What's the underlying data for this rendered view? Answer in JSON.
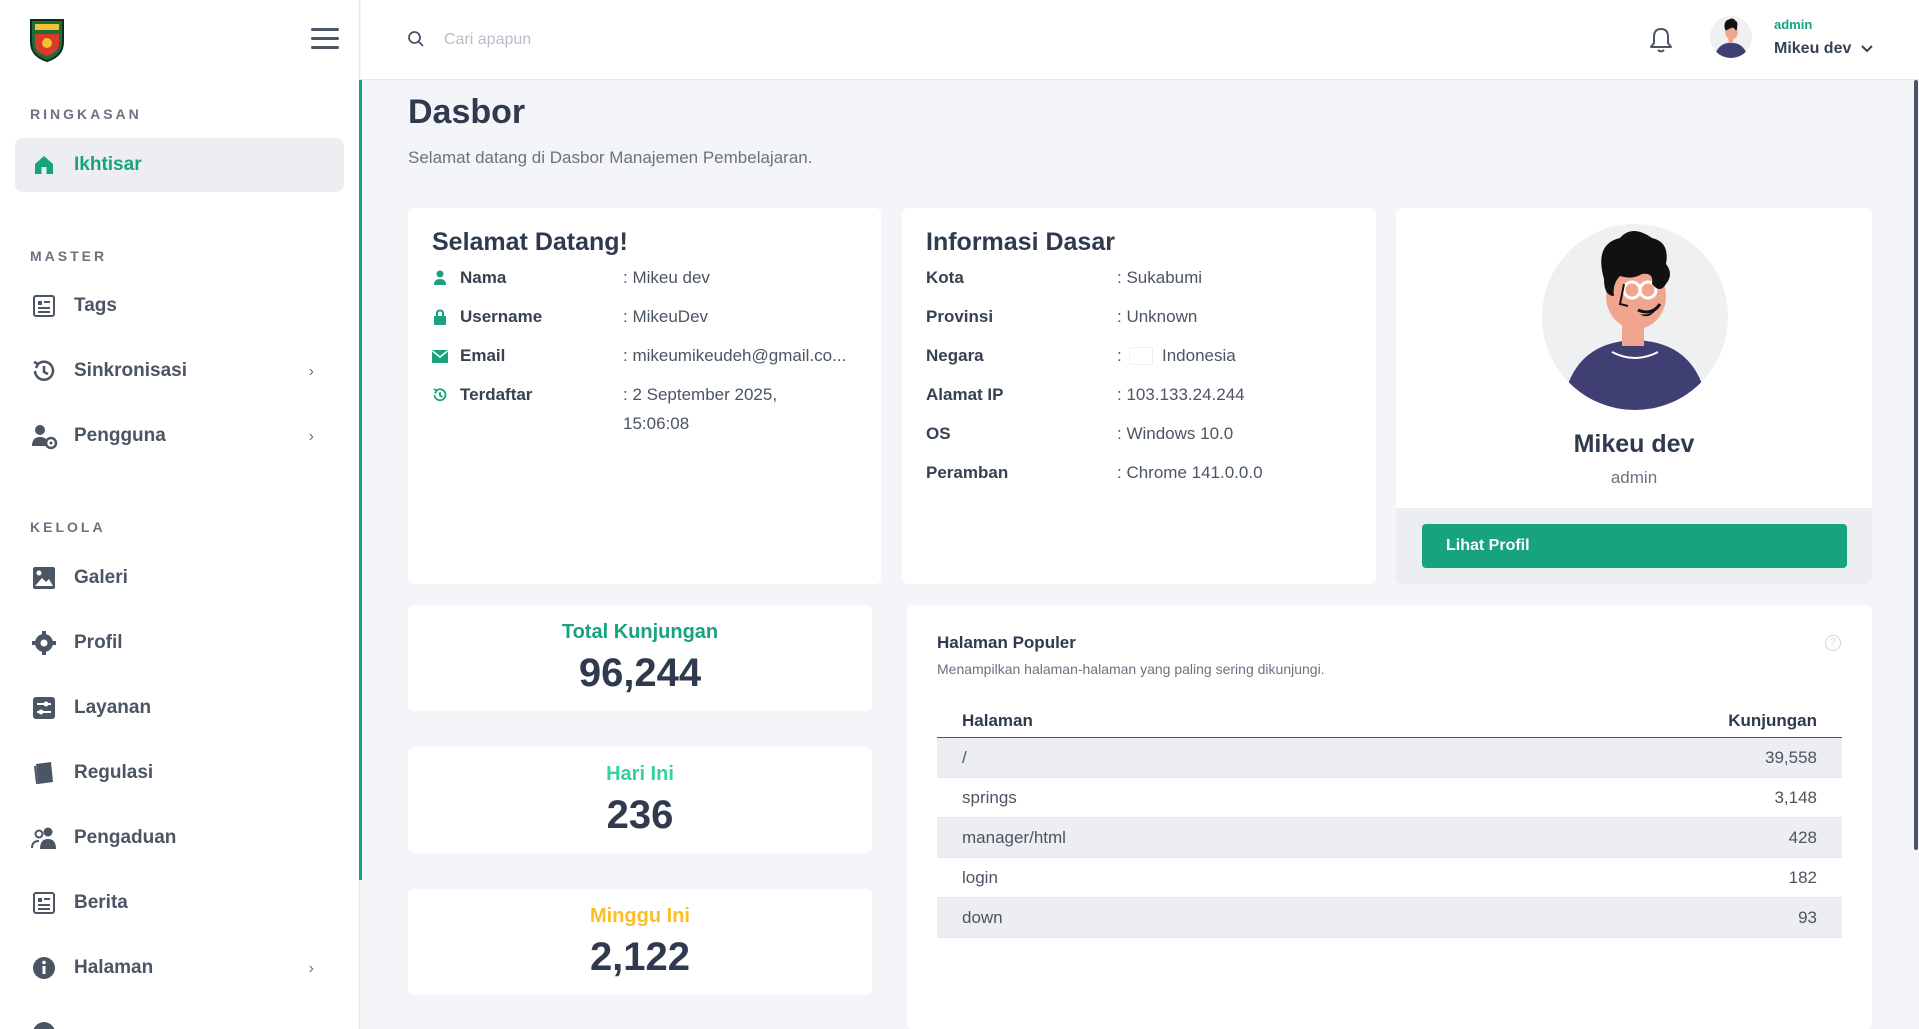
{
  "sidebar": {
    "sections": {
      "ringkasan": "RINGKASAN",
      "master": "MASTER",
      "kelola": "KELOLA"
    },
    "items": {
      "ikhtisar": "Ikhtisar",
      "tags": "Tags",
      "sinkronisasi": "Sinkronisasi",
      "pengguna": "Pengguna",
      "galeri": "Galeri",
      "profil": "Profil",
      "layanan": "Layanan",
      "regulasi": "Regulasi",
      "pengaduan": "Pengaduan",
      "berita": "Berita",
      "halaman": "Halaman"
    }
  },
  "header": {
    "search_placeholder": "Cari apapun",
    "user_role": "admin",
    "user_name": "Mikeu dev"
  },
  "page": {
    "title": "Dasbor",
    "subtitle": "Selamat datang di Dasbor Manajemen Pembelajaran."
  },
  "welcome": {
    "title": "Selamat Datang!",
    "rows": [
      {
        "label": "Nama",
        "value": ": Mikeu dev"
      },
      {
        "label": "Username",
        "value": ": MikeuDev"
      },
      {
        "label": "Email",
        "value": ": mikeumikeudeh@gmail.co..."
      },
      {
        "label": "Terdaftar",
        "value": ": 2 September 2025,",
        "value2": "15:06:08"
      }
    ]
  },
  "info": {
    "title": "Informasi Dasar",
    "rows": [
      {
        "label": "Kota",
        "value": ": Sukabumi"
      },
      {
        "label": "Provinsi",
        "value": ": Unknown"
      },
      {
        "label": "Negara",
        "value": "Indonesia",
        "prefix": ":"
      },
      {
        "label": "Alamat IP",
        "value": ": 103.133.24.244"
      },
      {
        "label": "OS",
        "value": ": Windows 10.0"
      },
      {
        "label": "Peramban",
        "value": ": Chrome 141.0.0.0"
      }
    ]
  },
  "profile": {
    "name": "Mikeu dev",
    "role": "admin",
    "button": "Lihat Profil"
  },
  "stats": [
    {
      "label": "Total Kunjungan",
      "value": "96,244",
      "color": "#16a37d"
    },
    {
      "label": "Hari Ini",
      "value": "236",
      "color": "#34d399"
    },
    {
      "label": "Minggu Ini",
      "value": "2,122",
      "color": "#fbbf24"
    }
  ],
  "popular": {
    "title": "Halaman Populer",
    "subtitle": "Menampilkan halaman-halaman yang paling sering dikunjungi.",
    "help": "?",
    "columns": {
      "page": "Halaman",
      "visits": "Kunjungan"
    },
    "rows": [
      {
        "page": "/",
        "visits": "39,558"
      },
      {
        "page": "springs",
        "visits": "3,148"
      },
      {
        "page": "manager/html",
        "visits": "428"
      },
      {
        "page": "login",
        "visits": "182"
      },
      {
        "page": "down",
        "visits": "93"
      }
    ]
  },
  "colors": {
    "accent": "#16a37d",
    "stat_today": "#34d399",
    "stat_week": "#fbbf24"
  }
}
